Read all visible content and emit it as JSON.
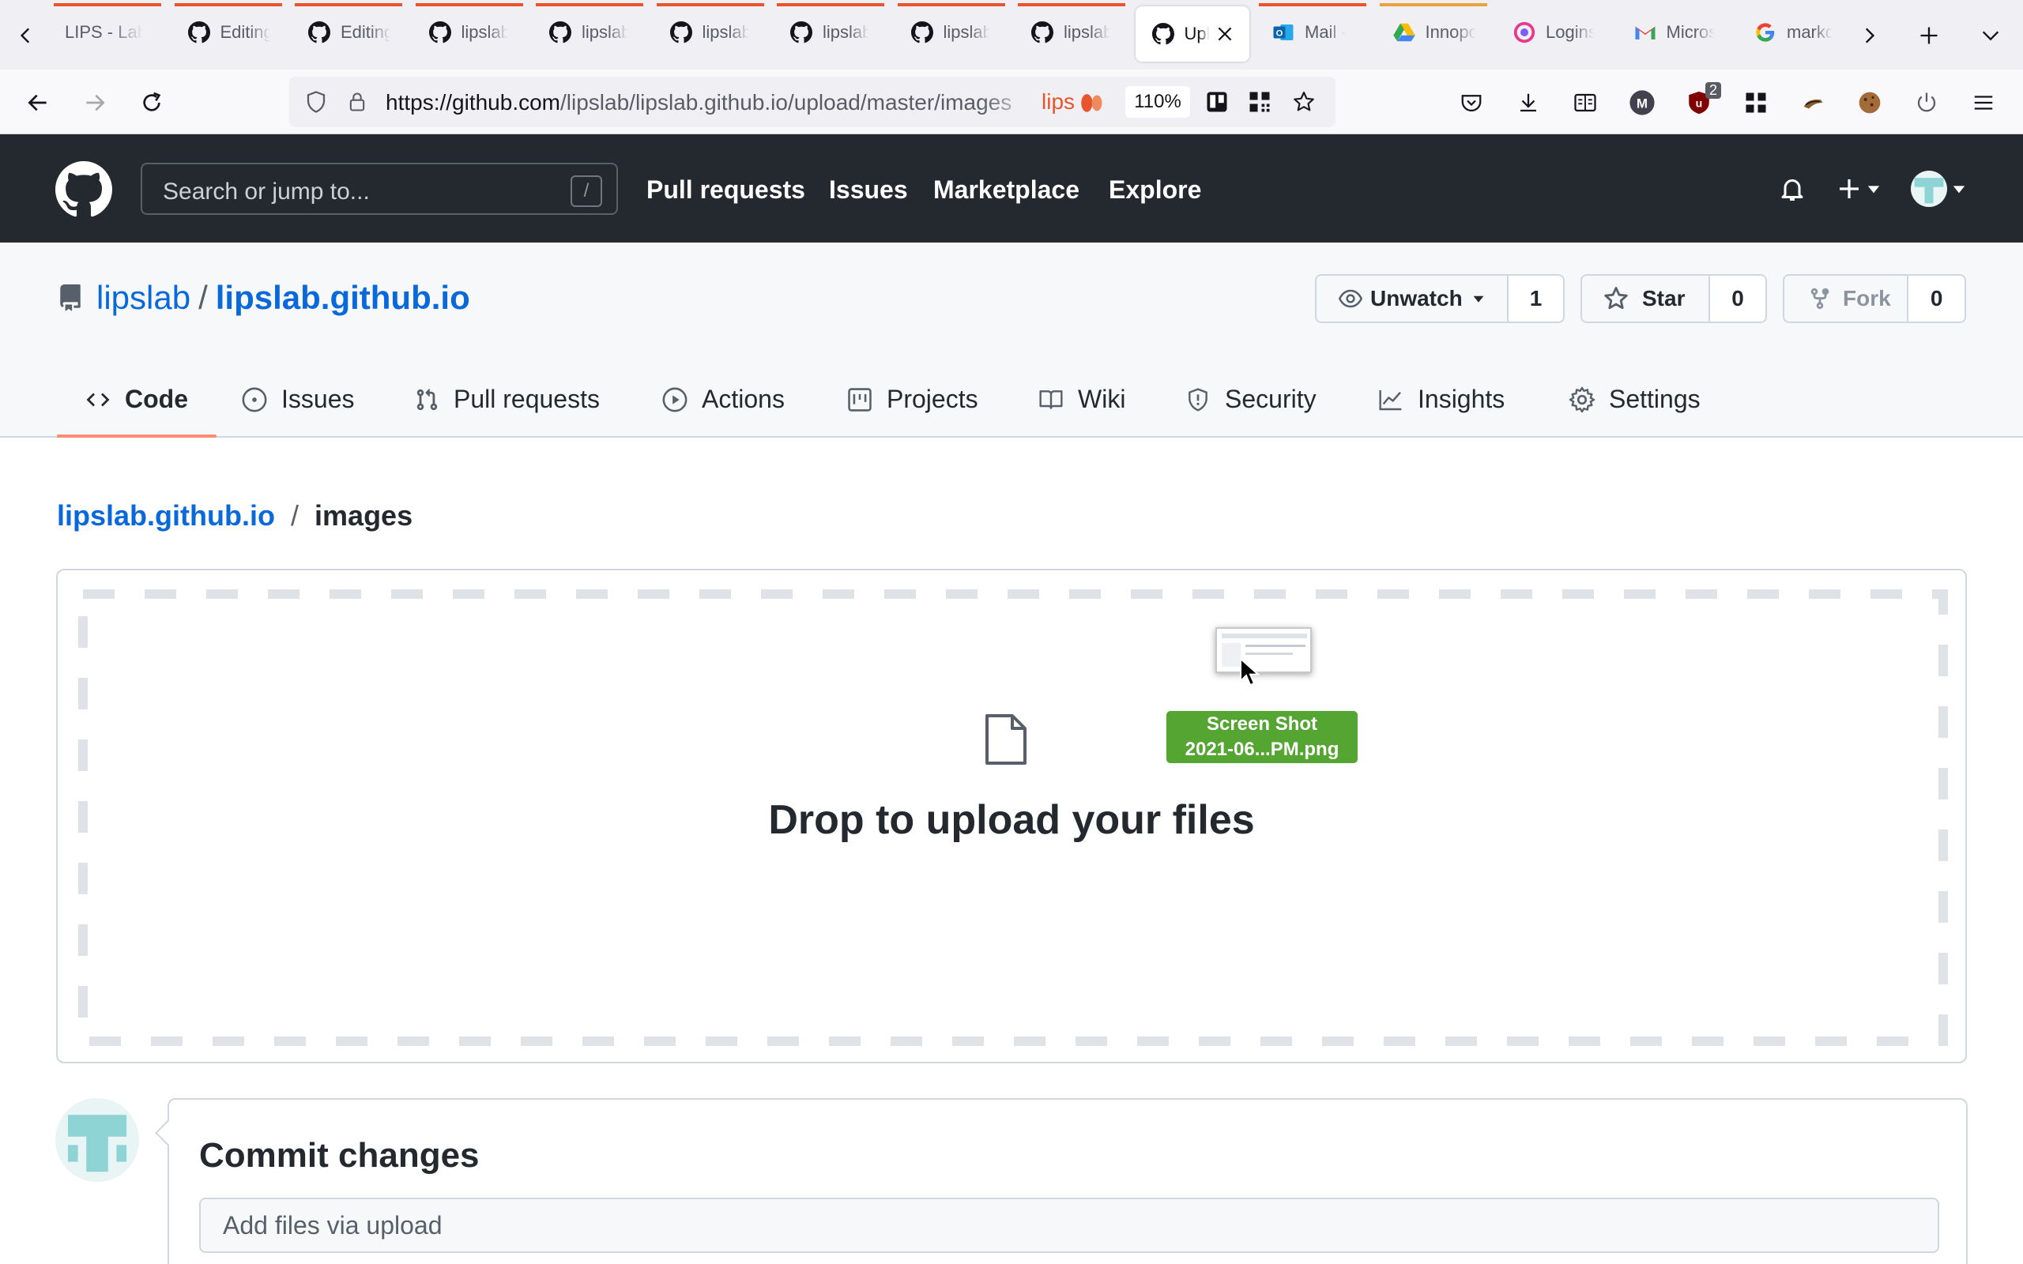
{
  "browser": {
    "tabs": [
      {
        "title": "LIPS - Lab",
        "icon": "lips-favicon",
        "bar": "#e8542c"
      },
      {
        "title": "Editing",
        "icon": "github-favicon",
        "bar": "#e8542c"
      },
      {
        "title": "Editing",
        "icon": "github-favicon",
        "bar": "#e8542c"
      },
      {
        "title": "lipslab",
        "icon": "github-favicon",
        "bar": "#e8542c"
      },
      {
        "title": "lipslab",
        "icon": "github-favicon",
        "bar": "#e8542c"
      },
      {
        "title": "lipslab",
        "icon": "github-favicon",
        "bar": "#e8542c"
      },
      {
        "title": "lipslab",
        "icon": "github-favicon",
        "bar": "#e8542c"
      },
      {
        "title": "lipslab",
        "icon": "github-favicon",
        "bar": "#e8542c"
      },
      {
        "title": "lipslab",
        "icon": "github-favicon",
        "bar": "#e8542c"
      },
      {
        "title": "Upl",
        "icon": "github-favicon",
        "bar": "",
        "active": true
      },
      {
        "title": "Mail -",
        "icon": "outlook-favicon",
        "bar": "#e8542c"
      },
      {
        "title": "Innopo",
        "icon": "drive-favicon",
        "bar": "#e8a33c"
      },
      {
        "title": "Logins",
        "icon": "lockwise-favicon",
        "bar": ""
      },
      {
        "title": "Micros",
        "icon": "gmail-favicon",
        "bar": ""
      },
      {
        "title": "markd",
        "icon": "google-favicon",
        "bar": ""
      }
    ],
    "url_host": "https://github.com",
    "url_path": "/lipslab/lipslab.github.io/upload/master/images",
    "extension_text": "lips",
    "zoom": "110%",
    "extension_badge": "2",
    "profile_initial": "M"
  },
  "github": {
    "search_placeholder": "Search or jump to...",
    "search_shortcut": "/",
    "nav": [
      "Pull requests",
      "Issues",
      "Marketplace",
      "Explore"
    ]
  },
  "repo": {
    "owner": "lipslab",
    "separator": "/",
    "name": "lipslab.github.io",
    "watch_label": "Unwatch",
    "watch_count": "1",
    "star_label": "Star",
    "star_count": "0",
    "fork_label": "Fork",
    "fork_count": "0",
    "tabs": [
      {
        "label": "Code",
        "icon": "code-icon",
        "selected": true
      },
      {
        "label": "Issues",
        "icon": "issue-icon"
      },
      {
        "label": "Pull requests",
        "icon": "pull-request-icon"
      },
      {
        "label": "Actions",
        "icon": "play-icon"
      },
      {
        "label": "Projects",
        "icon": "project-icon"
      },
      {
        "label": "Wiki",
        "icon": "book-icon"
      },
      {
        "label": "Security",
        "icon": "shield-icon"
      },
      {
        "label": "Insights",
        "icon": "graph-icon"
      },
      {
        "label": "Settings",
        "icon": "gear-icon"
      }
    ]
  },
  "main": {
    "breadcrumb_root": "lipslab.github.io",
    "breadcrumb_sep": "/",
    "breadcrumb_dir": "images",
    "dropzone_text": "Drop to upload your files",
    "drag_file_line1": "Screen Shot",
    "drag_file_line2": "2021-06...PM.png",
    "commit_title": "Commit changes",
    "commit_placeholder": "Add files via upload"
  }
}
